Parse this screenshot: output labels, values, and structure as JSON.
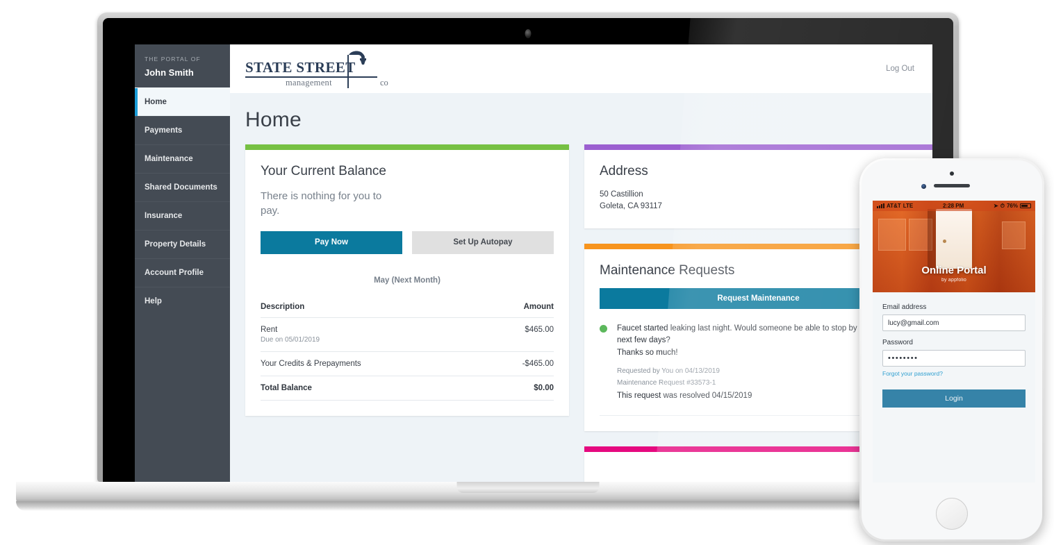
{
  "sidebar": {
    "kicker": "THE PORTAL OF",
    "user_name": "John Smith",
    "items": [
      {
        "label": "Home",
        "active": true
      },
      {
        "label": "Payments",
        "active": false
      },
      {
        "label": "Maintenance",
        "active": false
      },
      {
        "label": "Shared Documents",
        "active": false
      },
      {
        "label": "Insurance",
        "active": false
      },
      {
        "label": "Property Details",
        "active": false
      },
      {
        "label": "Account Profile",
        "active": false
      },
      {
        "label": "Help",
        "active": false
      }
    ]
  },
  "header": {
    "logo_name": "STATE STREET",
    "logo_sub": "management",
    "logo_suffix": "co",
    "logout_label": "Log Out"
  },
  "page": {
    "title": "Home"
  },
  "balance_card": {
    "accent_color": "#76c043",
    "title": "Your Current Balance",
    "message": "There is nothing for you to pay.",
    "pay_now_label": "Pay Now",
    "autopay_label": "Set Up Autopay",
    "month_label": "May (Next Month)",
    "columns": [
      "Description",
      "Amount"
    ],
    "rows": [
      {
        "description": "Rent",
        "sub": "Due on 05/01/2019",
        "amount": "$465.00",
        "bold": false
      },
      {
        "description": "Your Credits & Prepayments",
        "sub": "",
        "amount": "-$465.00",
        "bold": false
      },
      {
        "description": "Total Balance",
        "sub": "",
        "amount": "$0.00",
        "bold": true
      }
    ]
  },
  "address_card": {
    "accent_color": "#9b5fd0",
    "title": "Address",
    "street": "50 Castillion",
    "city_state_zip": "Goleta, CA 93117"
  },
  "maintenance_card": {
    "accent_color": "#f7941e",
    "title": "Maintenance Requests",
    "request_button_label": "Request Maintenance",
    "requests": [
      {
        "status_color": "#5cb85c",
        "body": "Faucet started leaking last night. Would someone be able to stop by and fix it in the next few days?",
        "body_line2": "Thanks so much!",
        "requested_by": "Requested by You on 04/13/2019",
        "request_id": "Maintenance Request #33573-1",
        "resolution": "This request was resolved 04/15/2019"
      }
    ]
  },
  "bottom_card": {
    "accent_color": "#e5097f"
  },
  "phone": {
    "status_bar": {
      "carrier": "AT&T",
      "network": "LTE",
      "time": "2:28 PM",
      "battery_percent": "76%"
    },
    "brand_main": "Online Portal",
    "brand_sub": "by appfolio",
    "email_label": "Email address",
    "email_value": "lucy@gmail.com",
    "password_label": "Password",
    "password_value": "••••••••",
    "forgot_label": "Forgot your password?",
    "login_label": "Login"
  }
}
